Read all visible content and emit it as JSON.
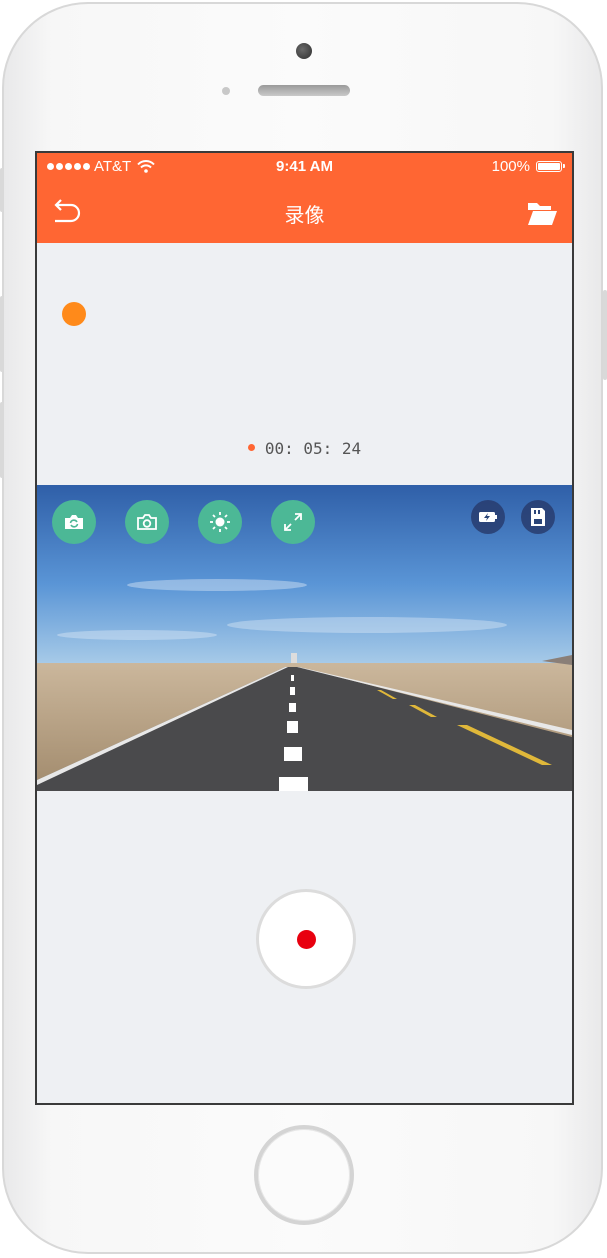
{
  "status_bar": {
    "carrier": "AT&T",
    "time": "9:41 AM",
    "battery": "100%"
  },
  "nav": {
    "title": "录像",
    "back_icon": "back-arrow-icon",
    "folder_icon": "folder-icon"
  },
  "recording": {
    "elapsed": "00: 05: 24"
  },
  "video_controls": [
    {
      "name": "switch-camera",
      "icon": "camera-rotate-icon"
    },
    {
      "name": "snapshot",
      "icon": "camera-icon"
    },
    {
      "name": "brightness",
      "icon": "sun-icon"
    },
    {
      "name": "fullscreen",
      "icon": "expand-icon"
    }
  ],
  "video_status": [
    {
      "name": "battery",
      "icon": "battery-charging-icon"
    },
    {
      "name": "sd-card",
      "icon": "sd-card-icon"
    }
  ],
  "colors": {
    "brand": "#ff6633",
    "control": "#4cb896",
    "record": "#e8000f",
    "indicator": "#ff8a1a"
  }
}
